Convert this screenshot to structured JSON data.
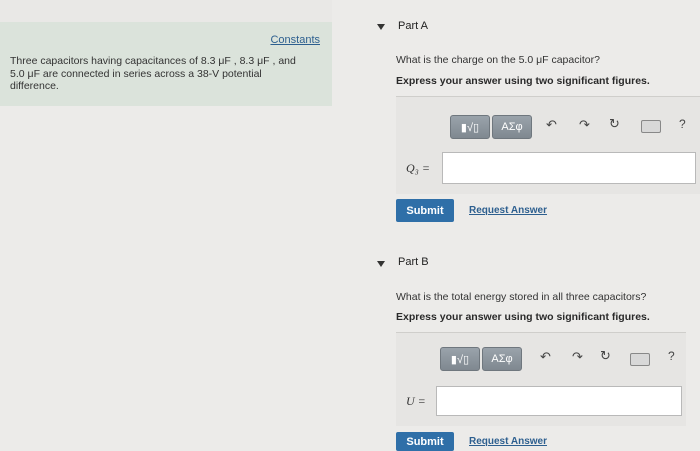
{
  "left": {
    "constants_label": "Constants",
    "problem_line1": "Three capacitors having capacitances of 8.3 μF , 8.3 μF , and",
    "problem_line2": "5.0 μF are connected in series across a 38-V potential",
    "problem_line3": "difference."
  },
  "partA": {
    "title": "Part A",
    "question": "What is the charge on the 5.0 μF capacitor?",
    "instruction": "Express your answer using two significant figures.",
    "var_label": "Q₃ =",
    "input_value": "",
    "submit_label": "Submit",
    "request_label": "Request Answer",
    "tool_templates": "▮√▯",
    "tool_greek": "ΑΣφ",
    "tool_help": "?"
  },
  "partB": {
    "title": "Part B",
    "question": "What is the total energy stored in all three capacitors?",
    "instruction": "Express your answer using two significant figures.",
    "var_label": "U =",
    "input_value": "",
    "submit_label": "Submit",
    "request_label": "Request Answer",
    "tool_templates": "▮√▯",
    "tool_greek": "ΑΣφ",
    "tool_help": "?"
  },
  "icons": {
    "undo": "undo-icon",
    "redo": "redo-icon",
    "reset": "reset-icon",
    "keyboard": "keyboard-icon"
  }
}
